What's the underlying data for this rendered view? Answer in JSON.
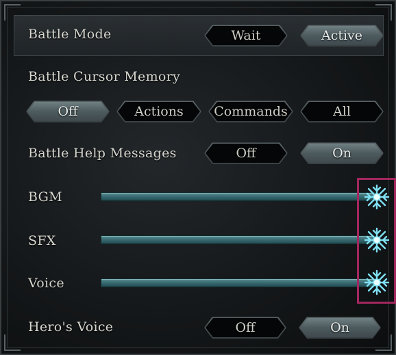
{
  "settings": {
    "battle_mode": {
      "label": "Battle Mode",
      "options": [
        "Wait",
        "Active"
      ],
      "selected": "Active"
    },
    "battle_cursor_memory": {
      "label": "Battle Cursor Memory",
      "options": [
        "Off",
        "Actions",
        "Commands",
        "All"
      ],
      "selected": "Off"
    },
    "battle_help_messages": {
      "label": "Battle Help Messages",
      "options": [
        "Off",
        "On"
      ],
      "selected": "On"
    },
    "bgm": {
      "label": "BGM",
      "level": 1.0
    },
    "sfx": {
      "label": "SFX",
      "level": 1.0
    },
    "voice": {
      "label": "Voice",
      "level": 1.0
    },
    "heros_voice": {
      "label": "Hero's Voice",
      "options": [
        "Off",
        "On"
      ],
      "selected": "On"
    }
  },
  "icons": {
    "slider_knob": "snowflake-icon"
  },
  "colors": {
    "slider_fill": "#3b6e74",
    "selected_button": "#5d6b6f",
    "highlight_box": "#a3275f",
    "knob": "#7fe0f2"
  }
}
